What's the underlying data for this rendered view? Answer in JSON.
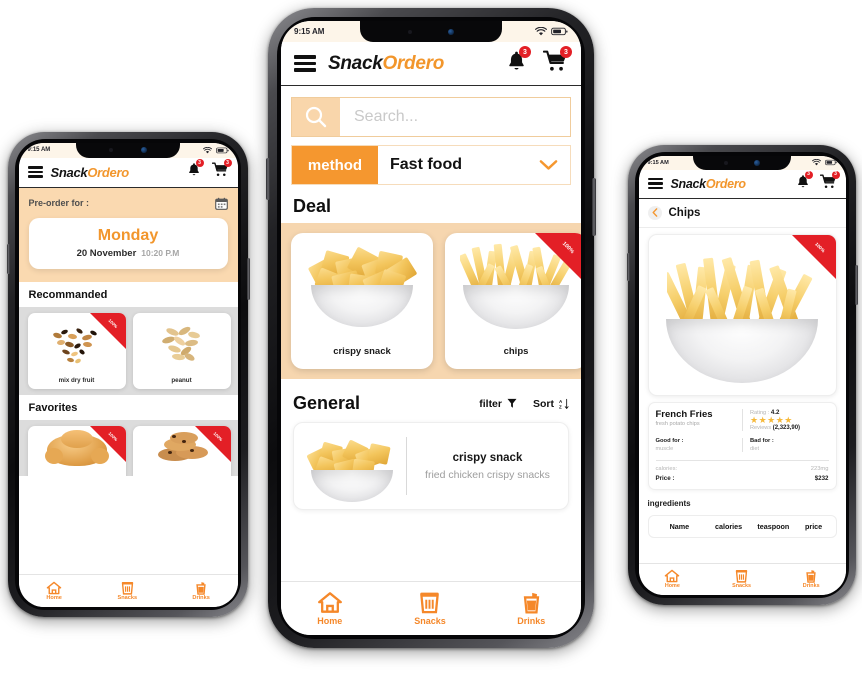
{
  "app": {
    "brand_part1": "Snack",
    "brand_part2": "Ordero",
    "status_time": "9:15 AM",
    "bell_badge": "3",
    "cart_badge": "3"
  },
  "bottom_nav": [
    {
      "label": "Home",
      "icon": "home-icon"
    },
    {
      "label": "Snacks",
      "icon": "trash-bucket-icon"
    },
    {
      "label": "Drinks",
      "icon": "drink-cup-icon"
    }
  ],
  "left_phone": {
    "preorder": {
      "label": "Pre-order for :",
      "calendar_icon": "calendar-icon",
      "day": "Monday",
      "date": "20 November",
      "time": "10:20 P.M"
    },
    "sections": [
      {
        "title": "Recommanded",
        "items": [
          {
            "caption": "mix dry fruit",
            "badge": "100%",
            "art": "mixnuts"
          },
          {
            "caption": "peanut",
            "badge": "",
            "art": "peanut"
          }
        ]
      },
      {
        "title": "Favorites",
        "items": [
          {
            "caption": "",
            "badge": "100%",
            "art": "croissant"
          },
          {
            "caption": "",
            "badge": "100%",
            "art": "cookies"
          }
        ]
      }
    ]
  },
  "center_phone": {
    "search": {
      "placeholder": "Search...",
      "value": "",
      "icon": "search-icon"
    },
    "method": {
      "tag": "method",
      "value": "Fast food",
      "chevron": "chevron-down-icon"
    },
    "deal": {
      "title": "Deal",
      "items": [
        {
          "caption": "crispy snack",
          "badge": "",
          "art": "chips"
        },
        {
          "caption": "chips",
          "badge": "100%",
          "art": "fries"
        }
      ]
    },
    "general": {
      "title": "General",
      "filter_label": "filter",
      "filter_icon": "funnel-icon",
      "sort_label": "Sort",
      "sort_icon": "sort-arrows-icon",
      "items": [
        {
          "name": "crispy snack",
          "desc": "fried chicken crispy snacks",
          "art": "chips"
        }
      ]
    }
  },
  "right_phone": {
    "header": {
      "back_icon": "chevron-left-icon",
      "title": "Chips"
    },
    "hero": {
      "badge": "100%",
      "art": "fries"
    },
    "product": {
      "name": "French Fries",
      "subtitle": "fresh potato chips",
      "rating_label": "Rating :",
      "rating_value": "4.2",
      "stars": "★★★★★",
      "reviews_label": "Reviews",
      "reviews_value": "(2,323,90)",
      "good_for_label": "Good for :",
      "good_for_value": "muscle",
      "bad_for_label": "Bad for :",
      "bad_for_value": "diet",
      "calories_label": "calories:",
      "calories_value": "223mg",
      "price_label": "Price :",
      "price_value": "$232"
    },
    "ingredients": {
      "title": "ingredients",
      "columns": [
        "Name",
        "calories",
        "teaspoon",
        "price"
      ]
    }
  },
  "colors": {
    "accent_orange": "#f5972f",
    "peach": "#fad9b0",
    "deal_bg": "#f6d6af",
    "badge_red": "#e31f26",
    "star_gold": "#f6b93b",
    "status_bg": "#fdf5e9"
  }
}
